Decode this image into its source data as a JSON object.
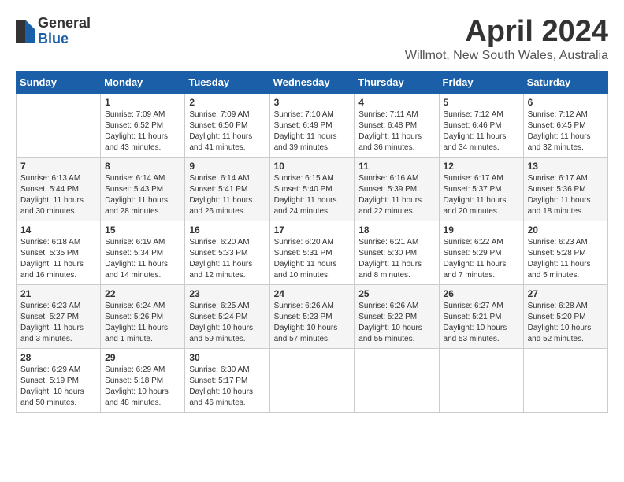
{
  "logo": {
    "general": "General",
    "blue": "Blue"
  },
  "title": "April 2024",
  "location": "Willmot, New South Wales, Australia",
  "days_of_week": [
    "Sunday",
    "Monday",
    "Tuesday",
    "Wednesday",
    "Thursday",
    "Friday",
    "Saturday"
  ],
  "weeks": [
    [
      {
        "day": "",
        "info": ""
      },
      {
        "day": "1",
        "info": "Sunrise: 7:09 AM\nSunset: 6:52 PM\nDaylight: 11 hours\nand 43 minutes."
      },
      {
        "day": "2",
        "info": "Sunrise: 7:09 AM\nSunset: 6:50 PM\nDaylight: 11 hours\nand 41 minutes."
      },
      {
        "day": "3",
        "info": "Sunrise: 7:10 AM\nSunset: 6:49 PM\nDaylight: 11 hours\nand 39 minutes."
      },
      {
        "day": "4",
        "info": "Sunrise: 7:11 AM\nSunset: 6:48 PM\nDaylight: 11 hours\nand 36 minutes."
      },
      {
        "day": "5",
        "info": "Sunrise: 7:12 AM\nSunset: 6:46 PM\nDaylight: 11 hours\nand 34 minutes."
      },
      {
        "day": "6",
        "info": "Sunrise: 7:12 AM\nSunset: 6:45 PM\nDaylight: 11 hours\nand 32 minutes."
      }
    ],
    [
      {
        "day": "7",
        "info": "Sunrise: 6:13 AM\nSunset: 5:44 PM\nDaylight: 11 hours\nand 30 minutes."
      },
      {
        "day": "8",
        "info": "Sunrise: 6:14 AM\nSunset: 5:43 PM\nDaylight: 11 hours\nand 28 minutes."
      },
      {
        "day": "9",
        "info": "Sunrise: 6:14 AM\nSunset: 5:41 PM\nDaylight: 11 hours\nand 26 minutes."
      },
      {
        "day": "10",
        "info": "Sunrise: 6:15 AM\nSunset: 5:40 PM\nDaylight: 11 hours\nand 24 minutes."
      },
      {
        "day": "11",
        "info": "Sunrise: 6:16 AM\nSunset: 5:39 PM\nDaylight: 11 hours\nand 22 minutes."
      },
      {
        "day": "12",
        "info": "Sunrise: 6:17 AM\nSunset: 5:37 PM\nDaylight: 11 hours\nand 20 minutes."
      },
      {
        "day": "13",
        "info": "Sunrise: 6:17 AM\nSunset: 5:36 PM\nDaylight: 11 hours\nand 18 minutes."
      }
    ],
    [
      {
        "day": "14",
        "info": "Sunrise: 6:18 AM\nSunset: 5:35 PM\nDaylight: 11 hours\nand 16 minutes."
      },
      {
        "day": "15",
        "info": "Sunrise: 6:19 AM\nSunset: 5:34 PM\nDaylight: 11 hours\nand 14 minutes."
      },
      {
        "day": "16",
        "info": "Sunrise: 6:20 AM\nSunset: 5:33 PM\nDaylight: 11 hours\nand 12 minutes."
      },
      {
        "day": "17",
        "info": "Sunrise: 6:20 AM\nSunset: 5:31 PM\nDaylight: 11 hours\nand 10 minutes."
      },
      {
        "day": "18",
        "info": "Sunrise: 6:21 AM\nSunset: 5:30 PM\nDaylight: 11 hours\nand 8 minutes."
      },
      {
        "day": "19",
        "info": "Sunrise: 6:22 AM\nSunset: 5:29 PM\nDaylight: 11 hours\nand 7 minutes."
      },
      {
        "day": "20",
        "info": "Sunrise: 6:23 AM\nSunset: 5:28 PM\nDaylight: 11 hours\nand 5 minutes."
      }
    ],
    [
      {
        "day": "21",
        "info": "Sunrise: 6:23 AM\nSunset: 5:27 PM\nDaylight: 11 hours\nand 3 minutes."
      },
      {
        "day": "22",
        "info": "Sunrise: 6:24 AM\nSunset: 5:26 PM\nDaylight: 11 hours\nand 1 minute."
      },
      {
        "day": "23",
        "info": "Sunrise: 6:25 AM\nSunset: 5:24 PM\nDaylight: 10 hours\nand 59 minutes."
      },
      {
        "day": "24",
        "info": "Sunrise: 6:26 AM\nSunset: 5:23 PM\nDaylight: 10 hours\nand 57 minutes."
      },
      {
        "day": "25",
        "info": "Sunrise: 6:26 AM\nSunset: 5:22 PM\nDaylight: 10 hours\nand 55 minutes."
      },
      {
        "day": "26",
        "info": "Sunrise: 6:27 AM\nSunset: 5:21 PM\nDaylight: 10 hours\nand 53 minutes."
      },
      {
        "day": "27",
        "info": "Sunrise: 6:28 AM\nSunset: 5:20 PM\nDaylight: 10 hours\nand 52 minutes."
      }
    ],
    [
      {
        "day": "28",
        "info": "Sunrise: 6:29 AM\nSunset: 5:19 PM\nDaylight: 10 hours\nand 50 minutes."
      },
      {
        "day": "29",
        "info": "Sunrise: 6:29 AM\nSunset: 5:18 PM\nDaylight: 10 hours\nand 48 minutes."
      },
      {
        "day": "30",
        "info": "Sunrise: 6:30 AM\nSunset: 5:17 PM\nDaylight: 10 hours\nand 46 minutes."
      },
      {
        "day": "",
        "info": ""
      },
      {
        "day": "",
        "info": ""
      },
      {
        "day": "",
        "info": ""
      },
      {
        "day": "",
        "info": ""
      }
    ]
  ]
}
